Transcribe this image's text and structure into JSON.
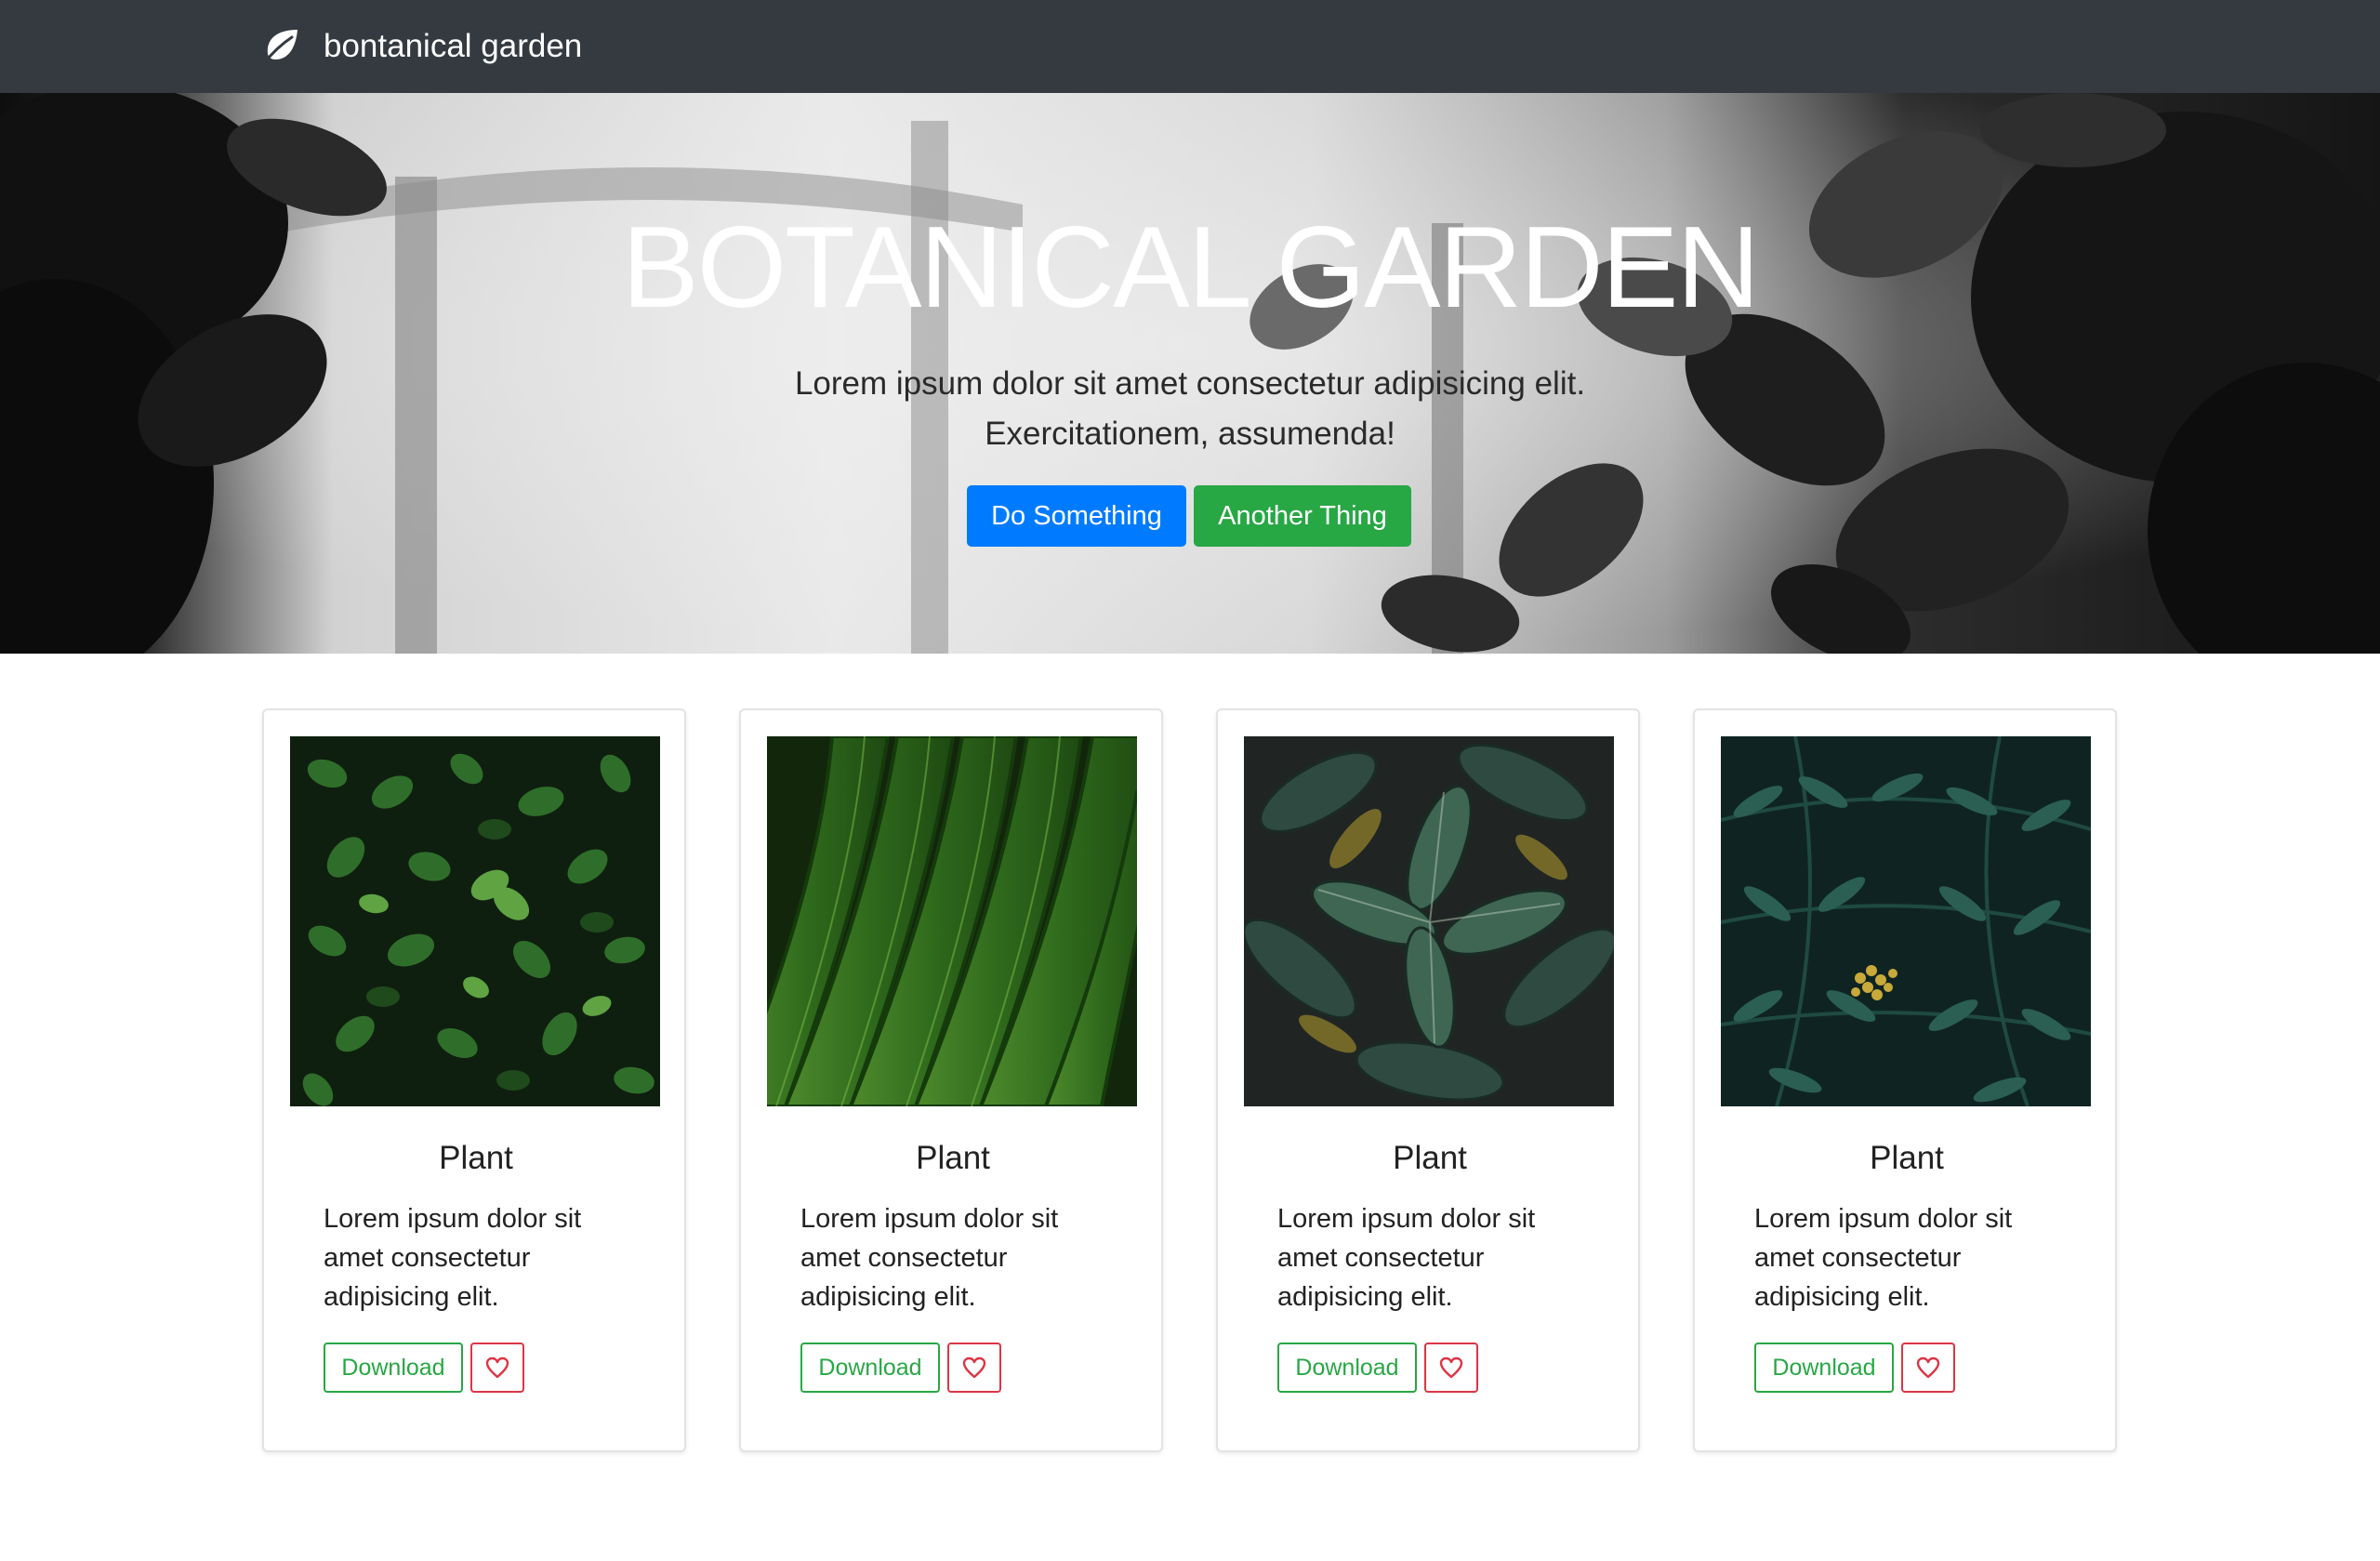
{
  "navbar": {
    "brand_label": "bontanical garden",
    "brand_icon": "leaf-icon",
    "background": "#343a40"
  },
  "hero": {
    "title": "BOTANICAL GARDEN",
    "lead_line1": "Lorem ipsum dolor sit amet consectetur adipisicing elit.",
    "lead_line2": "Exercitationem, assumenda!",
    "primary_button": "Do Something",
    "secondary_button": "Another Thing",
    "primary_color": "#007bff",
    "secondary_color": "#28a745"
  },
  "cards": [
    {
      "title": "Plant",
      "text": "Lorem ipsum dolor sit amet consectetur adipisicing elit.",
      "download_label": "Download",
      "like_icon": "heart-icon",
      "image": "clover-leaves-photo"
    },
    {
      "title": "Plant",
      "text": "Lorem ipsum dolor sit amet consectetur adipisicing elit.",
      "download_label": "Download",
      "like_icon": "heart-icon",
      "image": "palm-frond-photo"
    },
    {
      "title": "Plant",
      "text": "Lorem ipsum dolor sit amet consectetur adipisicing elit.",
      "download_label": "Download",
      "like_icon": "heart-icon",
      "image": "dark-leaves-photo"
    },
    {
      "title": "Plant",
      "text": "Lorem ipsum dolor sit amet consectetur adipisicing elit.",
      "download_label": "Download",
      "like_icon": "heart-icon",
      "image": "fern-photo"
    }
  ],
  "colors": {
    "outline_success": "#28a745",
    "outline_danger": "#dc3545"
  }
}
